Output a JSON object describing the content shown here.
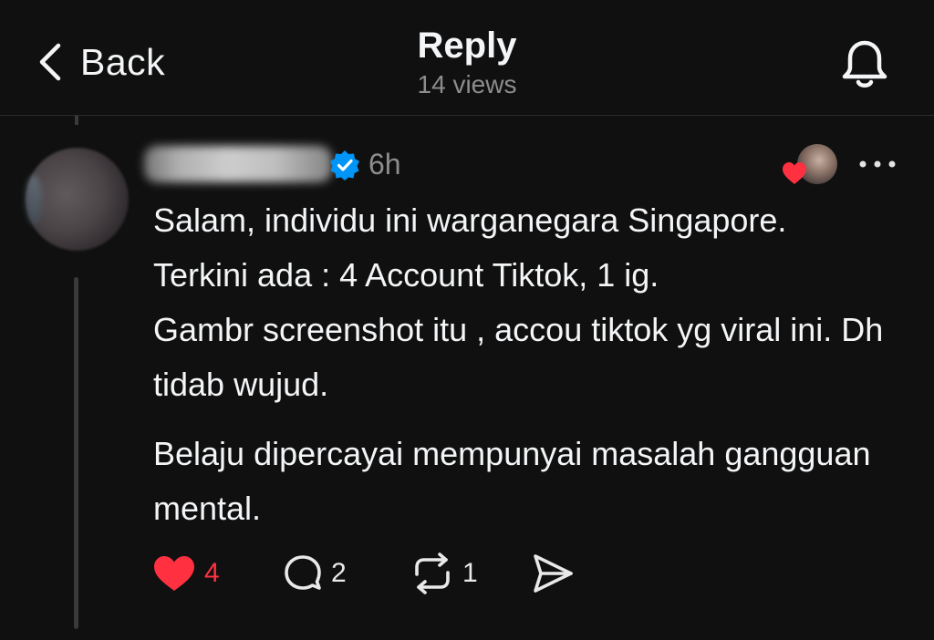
{
  "header": {
    "back_label": "Back",
    "title": "Reply",
    "views": "14 views"
  },
  "post": {
    "author_verified": true,
    "time": "6h",
    "paragraphs": [
      "Salam, individu ini warganegara Singapore.",
      "Terkini ada : 4 Account Tiktok, 1 ig.",
      "Gambr screenshot itu , accou tiktok yg viral ini. Dh tidab wujud.",
      "Belaju dipercayai mempunyai masalah gangguan mental."
    ],
    "actions": {
      "like_count": "4",
      "reply_count": "2",
      "repost_count": "1"
    }
  },
  "colors": {
    "background": "#101010",
    "text": "#f3f5f7",
    "muted": "#8d8d8d",
    "like_red": "#ff3040",
    "verified_blue": "#0095f6"
  },
  "icons": {
    "back": "chevron-left-icon",
    "notifications": "bell-icon",
    "verified": "verified-badge-icon",
    "more": "more-horizontal-icon",
    "like": "heart-icon",
    "reply": "comment-icon",
    "repost": "repost-icon",
    "share": "send-icon"
  }
}
